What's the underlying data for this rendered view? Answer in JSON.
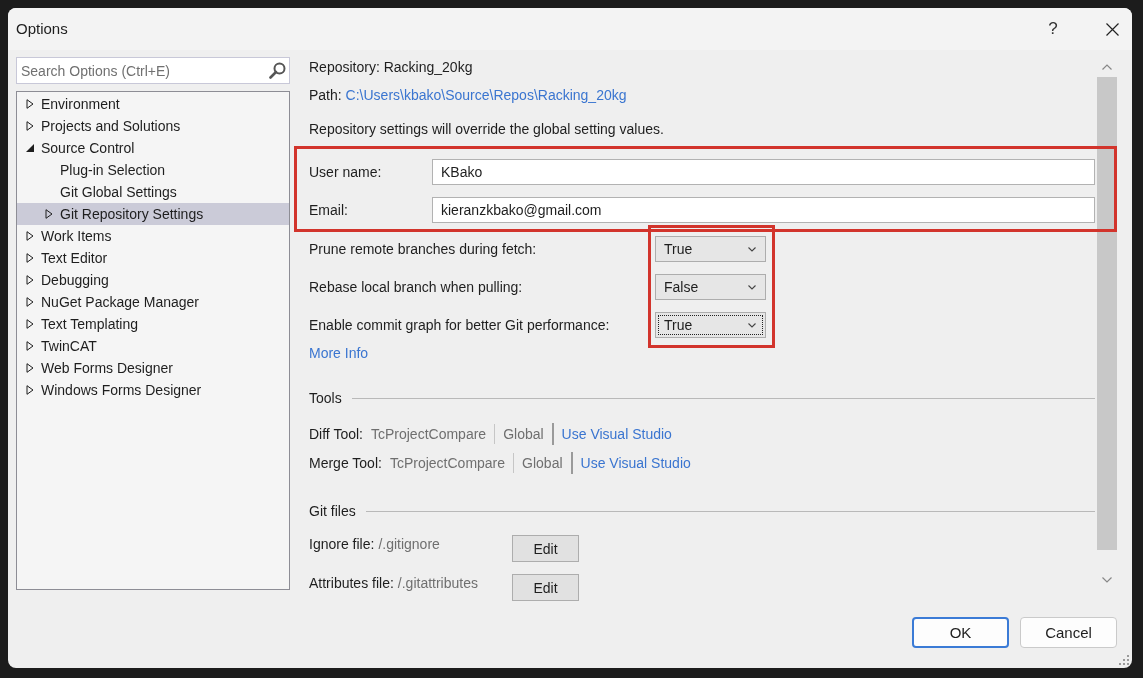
{
  "window": {
    "title": "Options",
    "help": "?"
  },
  "search": {
    "placeholder": "Search Options (Ctrl+E)"
  },
  "tree": [
    {
      "label": "Environment",
      "kind": "group",
      "expanded": false,
      "selected": false
    },
    {
      "label": "Projects and Solutions",
      "kind": "group",
      "expanded": false,
      "selected": false
    },
    {
      "label": "Source Control",
      "kind": "group",
      "expanded": true,
      "selected": false,
      "children": [
        {
          "label": "Plug-in Selection",
          "kind": "page",
          "selected": false
        },
        {
          "label": "Git Global Settings",
          "kind": "page",
          "selected": false
        },
        {
          "label": "Git Repository Settings",
          "kind": "group",
          "expanded": false,
          "selected": true
        }
      ]
    },
    {
      "label": "Work Items",
      "kind": "group",
      "expanded": false,
      "selected": false
    },
    {
      "label": "Text Editor",
      "kind": "group",
      "expanded": false,
      "selected": false
    },
    {
      "label": "Debugging",
      "kind": "group",
      "expanded": false,
      "selected": false
    },
    {
      "label": "NuGet Package Manager",
      "kind": "group",
      "expanded": false,
      "selected": false
    },
    {
      "label": "Text Templating",
      "kind": "group",
      "expanded": false,
      "selected": false
    },
    {
      "label": "TwinCAT",
      "kind": "group",
      "expanded": false,
      "selected": false
    },
    {
      "label": "Web Forms Designer",
      "kind": "group",
      "expanded": false,
      "selected": false
    },
    {
      "label": "Windows Forms Designer",
      "kind": "group",
      "expanded": false,
      "selected": false
    }
  ],
  "repository": "Repository: Racking_20kg",
  "path": {
    "label": "Path:",
    "value": "C:\\Users\\kbako\\Source\\Repos\\Racking_20kg"
  },
  "note": "Repository settings will override the global setting values.",
  "identity": {
    "highlighted": true,
    "fields": [
      {
        "label": "User name:",
        "value": "KBako"
      },
      {
        "label": "Email:",
        "value": "kieranzkbako@gmail.com"
      }
    ]
  },
  "git_options": {
    "highlighted": true,
    "rows": [
      {
        "label": "Prune remote branches during fetch:",
        "value": "True",
        "focused": false
      },
      {
        "label": "Rebase local branch when pulling:",
        "value": "False",
        "focused": false
      },
      {
        "label": "Enable commit graph for better Git performance:",
        "value": "True",
        "focused": true
      }
    ]
  },
  "more_info": "More Info",
  "tools": {
    "heading": "Tools",
    "rows": [
      {
        "label": "Diff Tool:",
        "current": "TcProjectCompare",
        "scope": "Global",
        "link": "Use Visual Studio"
      },
      {
        "label": "Merge Tool:",
        "current": "TcProjectCompare",
        "scope": "Global",
        "link": "Use Visual Studio"
      }
    ]
  },
  "git_files": {
    "heading": "Git files",
    "rows": [
      {
        "label": "Ignore file:",
        "path": "/.gitignore",
        "button": "Edit"
      },
      {
        "label": "Attributes file:",
        "path": "/.gitattributes",
        "button": "Edit"
      }
    ]
  },
  "buttons": [
    {
      "label": "OK",
      "default": true
    },
    {
      "label": "Cancel",
      "default": false
    }
  ]
}
